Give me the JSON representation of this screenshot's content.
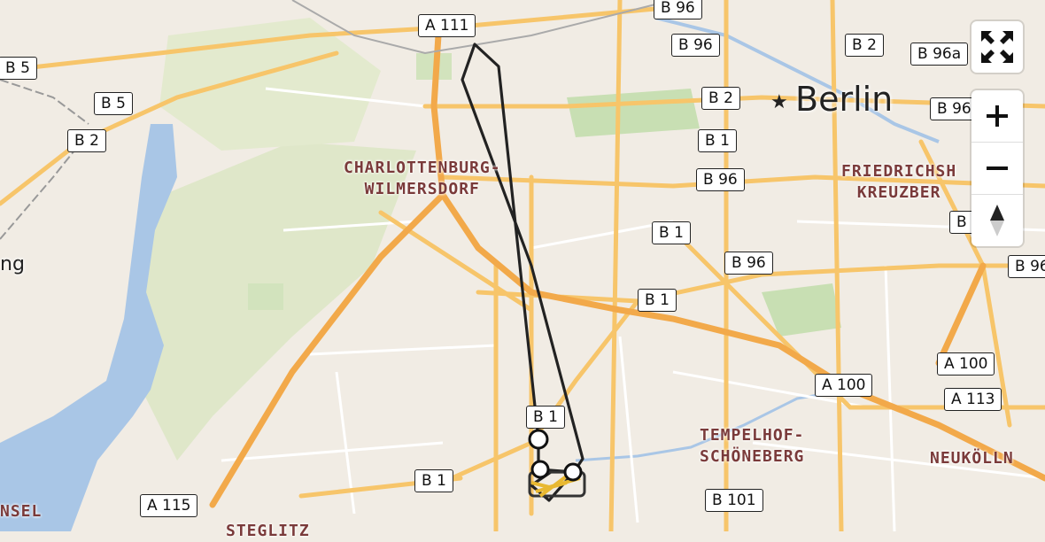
{
  "map": {
    "city_label": "Berlin",
    "districts": [
      {
        "id": "charlottenburg",
        "lines": [
          "CHARLOTTENBURG-",
          "WILMERSDORF"
        ]
      },
      {
        "id": "friedrichshain",
        "lines": [
          "FRIEDRICHSH",
          "KREUZBER"
        ]
      },
      {
        "id": "tempelhof",
        "lines": [
          "TEMPELHOF-",
          "SCHÖNEBERG"
        ]
      },
      {
        "id": "neukoelln",
        "lines": [
          "NEUKÖLLN"
        ]
      },
      {
        "id": "steglitz",
        "lines": [
          "STEGLITZ"
        ]
      },
      {
        "id": "nsel",
        "lines": [
          "NSEL"
        ]
      }
    ],
    "places": [
      {
        "id": "spandau-fragment",
        "label": "ng"
      }
    ],
    "road_shields": [
      "A 111",
      "B 96",
      "B 96",
      "B 2",
      "B 96a",
      "B 5",
      "B 5",
      "B 2",
      "B 2",
      "B 96",
      "B 1",
      "B 96",
      "B 1",
      "B 96",
      "B 96",
      "B 1",
      "A 100",
      "A 100",
      "A 113",
      "B 1",
      "B 1",
      "A 115",
      "B 101",
      "B 96"
    ],
    "route": {
      "color": "#222222",
      "waypoint_color": "#ffffff"
    }
  },
  "controls": {
    "fullscreen_icon": "fullscreen-icon",
    "zoom_in_icon": "plus-icon",
    "zoom_out_icon": "minus-icon",
    "reset_icon": "compass-icon"
  },
  "colors": {
    "land": "#f1ece4",
    "water": "#a9c6e6",
    "forest": "#dfe7c9",
    "park": "#c8dfb3",
    "major_road": "#f7c56a",
    "highway": "#f2a94a",
    "minor_road": "#ffffff",
    "route": "#222222"
  }
}
